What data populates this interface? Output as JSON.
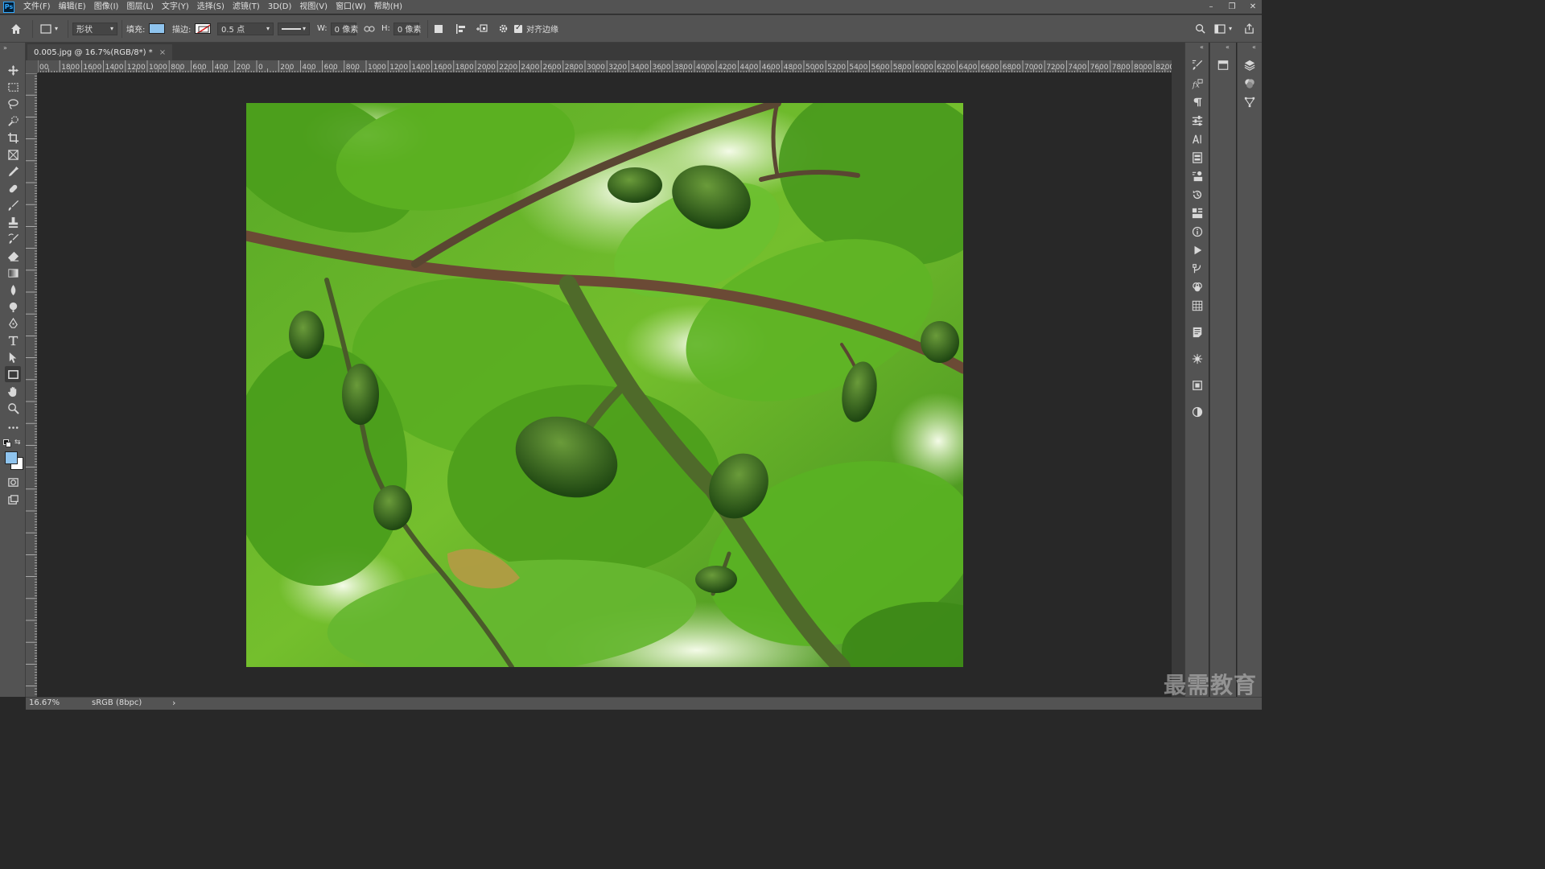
{
  "app": {
    "logo": "Ps"
  },
  "menu": [
    "文件(F)",
    "编辑(E)",
    "图像(I)",
    "图层(L)",
    "文字(Y)",
    "选择(S)",
    "滤镜(T)",
    "3D(D)",
    "视图(V)",
    "窗口(W)",
    "帮助(H)"
  ],
  "options": {
    "mode": "形状",
    "fill_label": "填充:",
    "fill_color": "#8fc4ee",
    "stroke_label": "描边:",
    "stroke_width": "0.5 点",
    "w_label": "W:",
    "w_value": "0 像素",
    "h_label": "H:",
    "h_value": "0 像素",
    "align_edges_label": "对齐边缘",
    "align_edges_checked": true
  },
  "document": {
    "tab_title": "0.005.jpg @ 16.7%(RGB/8*) *",
    "close": "×"
  },
  "ruler": {
    "labels": [
      "00",
      "1800",
      "1600",
      "1400",
      "1200",
      "1000",
      "800",
      "600",
      "400",
      "200",
      "0",
      "200",
      "400",
      "600",
      "800",
      "1000",
      "1200",
      "1400",
      "1600",
      "1800",
      "2000",
      "2200",
      "2400",
      "2600",
      "2800",
      "3000",
      "3200",
      "3400",
      "3600",
      "3800",
      "4000",
      "4200",
      "4400",
      "4600",
      "4800",
      "5000",
      "5200",
      "5400",
      "5600",
      "5800",
      "6000",
      "6200",
      "6400",
      "6600",
      "6800",
      "7000",
      "7200",
      "7400",
      "7600",
      "7800",
      "8000",
      "8200",
      "8"
    ]
  },
  "status": {
    "zoom": "16.67%",
    "color_profile": "sRGB (8bpc)",
    "arrow": "›"
  },
  "watermark": "最需教育",
  "colors": {
    "foreground": "#8fc4ee",
    "background": "#ffffff"
  }
}
